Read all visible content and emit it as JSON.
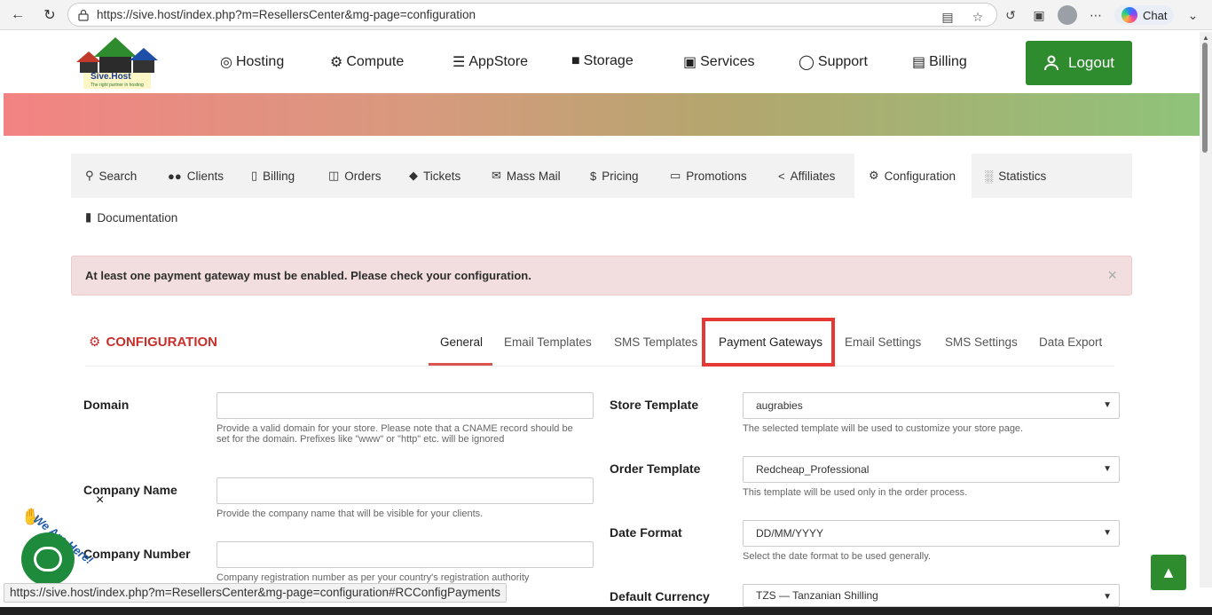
{
  "browser": {
    "url": "https://sive.host/index.php?m=ResellersCenter&mg-page=configuration",
    "chat_label": "Chat"
  },
  "header": {
    "logo_text": "Sive.Host",
    "logo_tagline": "The right partner in hosting",
    "nav": [
      "Hosting",
      "Compute",
      "AppStore",
      "Storage",
      "Services",
      "Support",
      "Billing"
    ],
    "logout_label": "Logout"
  },
  "rc_tabs": {
    "items": [
      "Search",
      "Clients",
      "Billing",
      "Orders",
      "Tickets",
      "Mass Mail",
      "Pricing",
      "Promotions",
      "Affiliates",
      "Configuration",
      "Statistics"
    ],
    "documentation": "Documentation"
  },
  "alert": {
    "text": "At least one payment gateway must be enabled. Please check your configuration.",
    "close": "×"
  },
  "config": {
    "title": "CONFIGURATION",
    "tabs": [
      "General",
      "Email Templates",
      "SMS Templates",
      "Payment Gateways",
      "Email Settings",
      "SMS Settings",
      "Data Export"
    ]
  },
  "form": {
    "domain_label": "Domain",
    "domain_help": "Provide a valid domain for your store. Please note that a CNAME record should be set for the domain. Prefixes like \"www\" or \"http\" etc. will be ignored",
    "company_name_label": "Company Name",
    "company_name_help": "Provide the company name that will be visible for your clients.",
    "company_number_label": "Company Number",
    "company_number_help": "Company registration number as per your country's registration authority",
    "store_template_label": "Store Template",
    "store_template_value": "augrabies",
    "store_template_help": "The selected template will be used to customize your store page.",
    "order_template_label": "Order Template",
    "order_template_value": "Redcheap_Professional",
    "order_template_help": "This template will be used only in the order process.",
    "date_format_label": "Date Format",
    "date_format_value": "DD/MM/YYYY",
    "date_format_help": "Select the date format to be used generally.",
    "default_currency_label": "Default Currency",
    "default_currency_value": "TZS — Tanzanian Shilling"
  },
  "chat_widget": {
    "text": "We Are Here!",
    "close": "×"
  },
  "status_url": "https://sive.host/index.php?m=ResellersCenter&mg-page=configuration#RCConfigPayments"
}
